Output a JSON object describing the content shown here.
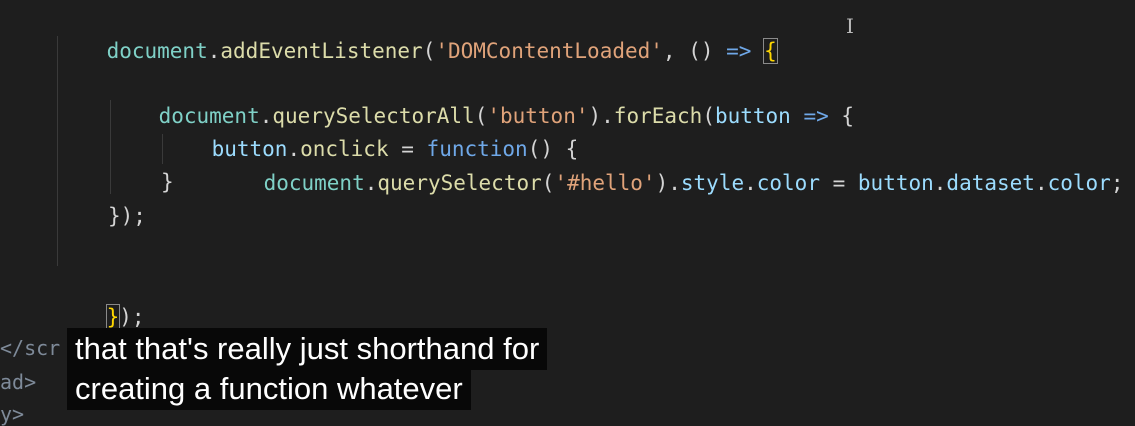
{
  "code": {
    "line1": [
      "document",
      ".",
      "addEventListener",
      "(",
      "'DOMContentLoaded'",
      ", () ",
      "=>",
      " ",
      "{"
    ],
    "line2": [
      "document",
      ".",
      "querySelectorAll",
      "(",
      "'button'",
      ").",
      "forEach",
      "(",
      "button",
      " ",
      "=>",
      " {"
    ],
    "line3": [
      "button",
      ".",
      "onclick",
      " = ",
      "function",
      "() {"
    ],
    "line4": [
      "document",
      ".",
      "querySelector",
      "(",
      "'#hello'",
      ").",
      "style",
      ".",
      "color",
      " = ",
      "button",
      ".",
      "dataset",
      ".",
      "color",
      ";"
    ],
    "line5": "}",
    "line6": "});",
    "line7": [
      "}",
      ");"
    ]
  },
  "left_gutter": {
    "tag1": "</scr",
    "tag2": "ad>",
    "tag3": "y>"
  },
  "caption": {
    "line1": "that that's really just shorthand for",
    "line2": "creating a function whatever"
  },
  "cursor_glyph": "I"
}
